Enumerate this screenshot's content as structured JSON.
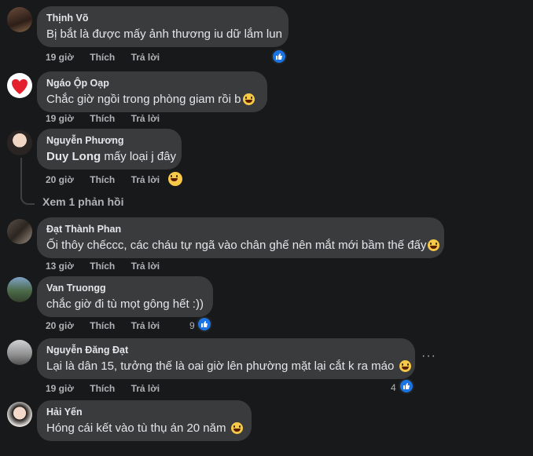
{
  "comments": [
    {
      "author": "Thịnh Võ",
      "text": "Bị bắt là được mấy ảnh thương iu dữ lắm lun",
      "time": "19 giờ",
      "like": "Thích",
      "reply": "Trả lời",
      "reaction_count": ""
    },
    {
      "author": "Ngáo Ộp Oạp",
      "text": "Chắc giờ ngồi trong phòng giam rồi b",
      "time": "19 giờ",
      "like": "Thích",
      "reply": "Trả lời",
      "reaction_count": ""
    },
    {
      "author": "Nguyễn Phương",
      "mention": "Duy Long",
      "text": "mấy loại j đây",
      "time": "20 giờ",
      "like": "Thích",
      "reply": "Trả lời",
      "reaction_count": ""
    },
    {
      "author": "Đạt Thành Phan",
      "text": "Ối thôy chếccc, các cháu tự ngã vào chân ghế nên mắt mới bầm thế đấy",
      "time": "13 giờ",
      "like": "Thích",
      "reply": "Trả lời",
      "reaction_count": ""
    },
    {
      "author": "Van Truongg",
      "text": "chắc giờ đi tù mọt gông hết :))",
      "time": "20 giờ",
      "like": "Thích",
      "reply": "Trả lời",
      "reaction_count": "9"
    },
    {
      "author": "Nguyễn Đăng Đạt",
      "text": "Lại là dân 15, tưởng thế là oai giờ lên phường mặt lại cắt k ra máo",
      "time": "19 giờ",
      "like": "Thích",
      "reply": "Trả lời",
      "reaction_count": "4"
    },
    {
      "author": "Hải Yến",
      "text": "Hóng cái kết vào tù thụ án 20 năm",
      "time": "",
      "like": "",
      "reply": "",
      "reaction_count": ""
    }
  ],
  "view_replies": "Xem 1 phản hồi",
  "more_options": "···",
  "colors": {
    "background": "#18191a",
    "bubble": "#3a3b3c",
    "secondary_text": "#b0b3b8",
    "like_blue": "#1b74e4"
  }
}
